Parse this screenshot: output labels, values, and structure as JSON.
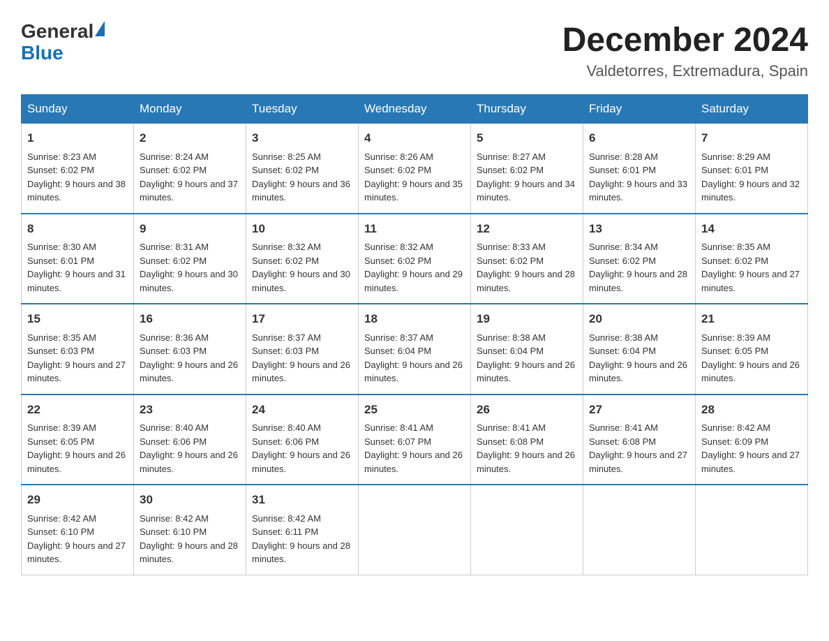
{
  "header": {
    "logo": {
      "general": "General",
      "blue": "Blue"
    },
    "title": "December 2024",
    "subtitle": "Valdetorres, Extremadura, Spain"
  },
  "columns": [
    "Sunday",
    "Monday",
    "Tuesday",
    "Wednesday",
    "Thursday",
    "Friday",
    "Saturday"
  ],
  "weeks": [
    [
      {
        "day": "1",
        "sunrise": "Sunrise: 8:23 AM",
        "sunset": "Sunset: 6:02 PM",
        "daylight": "Daylight: 9 hours and 38 minutes."
      },
      {
        "day": "2",
        "sunrise": "Sunrise: 8:24 AM",
        "sunset": "Sunset: 6:02 PM",
        "daylight": "Daylight: 9 hours and 37 minutes."
      },
      {
        "day": "3",
        "sunrise": "Sunrise: 8:25 AM",
        "sunset": "Sunset: 6:02 PM",
        "daylight": "Daylight: 9 hours and 36 minutes."
      },
      {
        "day": "4",
        "sunrise": "Sunrise: 8:26 AM",
        "sunset": "Sunset: 6:02 PM",
        "daylight": "Daylight: 9 hours and 35 minutes."
      },
      {
        "day": "5",
        "sunrise": "Sunrise: 8:27 AM",
        "sunset": "Sunset: 6:02 PM",
        "daylight": "Daylight: 9 hours and 34 minutes."
      },
      {
        "day": "6",
        "sunrise": "Sunrise: 8:28 AM",
        "sunset": "Sunset: 6:01 PM",
        "daylight": "Daylight: 9 hours and 33 minutes."
      },
      {
        "day": "7",
        "sunrise": "Sunrise: 8:29 AM",
        "sunset": "Sunset: 6:01 PM",
        "daylight": "Daylight: 9 hours and 32 minutes."
      }
    ],
    [
      {
        "day": "8",
        "sunrise": "Sunrise: 8:30 AM",
        "sunset": "Sunset: 6:01 PM",
        "daylight": "Daylight: 9 hours and 31 minutes."
      },
      {
        "day": "9",
        "sunrise": "Sunrise: 8:31 AM",
        "sunset": "Sunset: 6:02 PM",
        "daylight": "Daylight: 9 hours and 30 minutes."
      },
      {
        "day": "10",
        "sunrise": "Sunrise: 8:32 AM",
        "sunset": "Sunset: 6:02 PM",
        "daylight": "Daylight: 9 hours and 30 minutes."
      },
      {
        "day": "11",
        "sunrise": "Sunrise: 8:32 AM",
        "sunset": "Sunset: 6:02 PM",
        "daylight": "Daylight: 9 hours and 29 minutes."
      },
      {
        "day": "12",
        "sunrise": "Sunrise: 8:33 AM",
        "sunset": "Sunset: 6:02 PM",
        "daylight": "Daylight: 9 hours and 28 minutes."
      },
      {
        "day": "13",
        "sunrise": "Sunrise: 8:34 AM",
        "sunset": "Sunset: 6:02 PM",
        "daylight": "Daylight: 9 hours and 28 minutes."
      },
      {
        "day": "14",
        "sunrise": "Sunrise: 8:35 AM",
        "sunset": "Sunset: 6:02 PM",
        "daylight": "Daylight: 9 hours and 27 minutes."
      }
    ],
    [
      {
        "day": "15",
        "sunrise": "Sunrise: 8:35 AM",
        "sunset": "Sunset: 6:03 PM",
        "daylight": "Daylight: 9 hours and 27 minutes."
      },
      {
        "day": "16",
        "sunrise": "Sunrise: 8:36 AM",
        "sunset": "Sunset: 6:03 PM",
        "daylight": "Daylight: 9 hours and 26 minutes."
      },
      {
        "day": "17",
        "sunrise": "Sunrise: 8:37 AM",
        "sunset": "Sunset: 6:03 PM",
        "daylight": "Daylight: 9 hours and 26 minutes."
      },
      {
        "day": "18",
        "sunrise": "Sunrise: 8:37 AM",
        "sunset": "Sunset: 6:04 PM",
        "daylight": "Daylight: 9 hours and 26 minutes."
      },
      {
        "day": "19",
        "sunrise": "Sunrise: 8:38 AM",
        "sunset": "Sunset: 6:04 PM",
        "daylight": "Daylight: 9 hours and 26 minutes."
      },
      {
        "day": "20",
        "sunrise": "Sunrise: 8:38 AM",
        "sunset": "Sunset: 6:04 PM",
        "daylight": "Daylight: 9 hours and 26 minutes."
      },
      {
        "day": "21",
        "sunrise": "Sunrise: 8:39 AM",
        "sunset": "Sunset: 6:05 PM",
        "daylight": "Daylight: 9 hours and 26 minutes."
      }
    ],
    [
      {
        "day": "22",
        "sunrise": "Sunrise: 8:39 AM",
        "sunset": "Sunset: 6:05 PM",
        "daylight": "Daylight: 9 hours and 26 minutes."
      },
      {
        "day": "23",
        "sunrise": "Sunrise: 8:40 AM",
        "sunset": "Sunset: 6:06 PM",
        "daylight": "Daylight: 9 hours and 26 minutes."
      },
      {
        "day": "24",
        "sunrise": "Sunrise: 8:40 AM",
        "sunset": "Sunset: 6:06 PM",
        "daylight": "Daylight: 9 hours and 26 minutes."
      },
      {
        "day": "25",
        "sunrise": "Sunrise: 8:41 AM",
        "sunset": "Sunset: 6:07 PM",
        "daylight": "Daylight: 9 hours and 26 minutes."
      },
      {
        "day": "26",
        "sunrise": "Sunrise: 8:41 AM",
        "sunset": "Sunset: 6:08 PM",
        "daylight": "Daylight: 9 hours and 26 minutes."
      },
      {
        "day": "27",
        "sunrise": "Sunrise: 8:41 AM",
        "sunset": "Sunset: 6:08 PM",
        "daylight": "Daylight: 9 hours and 27 minutes."
      },
      {
        "day": "28",
        "sunrise": "Sunrise: 8:42 AM",
        "sunset": "Sunset: 6:09 PM",
        "daylight": "Daylight: 9 hours and 27 minutes."
      }
    ],
    [
      {
        "day": "29",
        "sunrise": "Sunrise: 8:42 AM",
        "sunset": "Sunset: 6:10 PM",
        "daylight": "Daylight: 9 hours and 27 minutes."
      },
      {
        "day": "30",
        "sunrise": "Sunrise: 8:42 AM",
        "sunset": "Sunset: 6:10 PM",
        "daylight": "Daylight: 9 hours and 28 minutes."
      },
      {
        "day": "31",
        "sunrise": "Sunrise: 8:42 AM",
        "sunset": "Sunset: 6:11 PM",
        "daylight": "Daylight: 9 hours and 28 minutes."
      },
      null,
      null,
      null,
      null
    ]
  ]
}
